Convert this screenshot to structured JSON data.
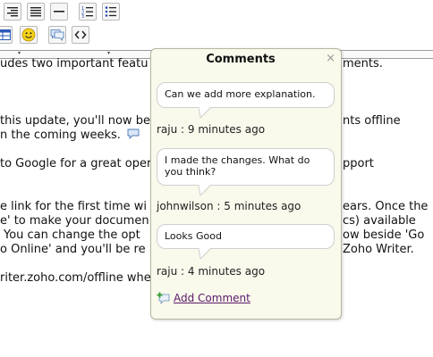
{
  "document": {
    "lines": [
      "udes two important featu",
      "ments.",
      "this update, you'll now be",
      "nts offline",
      "n the coming weeks.",
      "to Google for a great oper",
      "pport",
      "e link for the first time wi",
      "ears. Once the",
      "e' to make your documen",
      "cs) available",
      "You can change the opt",
      "ow beside 'Go",
      "o Online' and you'll be re",
      "Zoho Writer.",
      "riter.zoho.com/offline whe"
    ]
  },
  "comments_popup": {
    "title": "Comments",
    "close_glyph": "×",
    "comments": [
      {
        "text": "Can we add more explanation.",
        "author_line": "raju : 9 minutes ago"
      },
      {
        "text": "I made the changes. What do you think?",
        "author_line": "johnwilson : 5 minutes ago"
      },
      {
        "text": "Looks Good",
        "author_line": "raju : 4 minutes ago"
      }
    ],
    "add_comment_label": "Add Comment"
  }
}
